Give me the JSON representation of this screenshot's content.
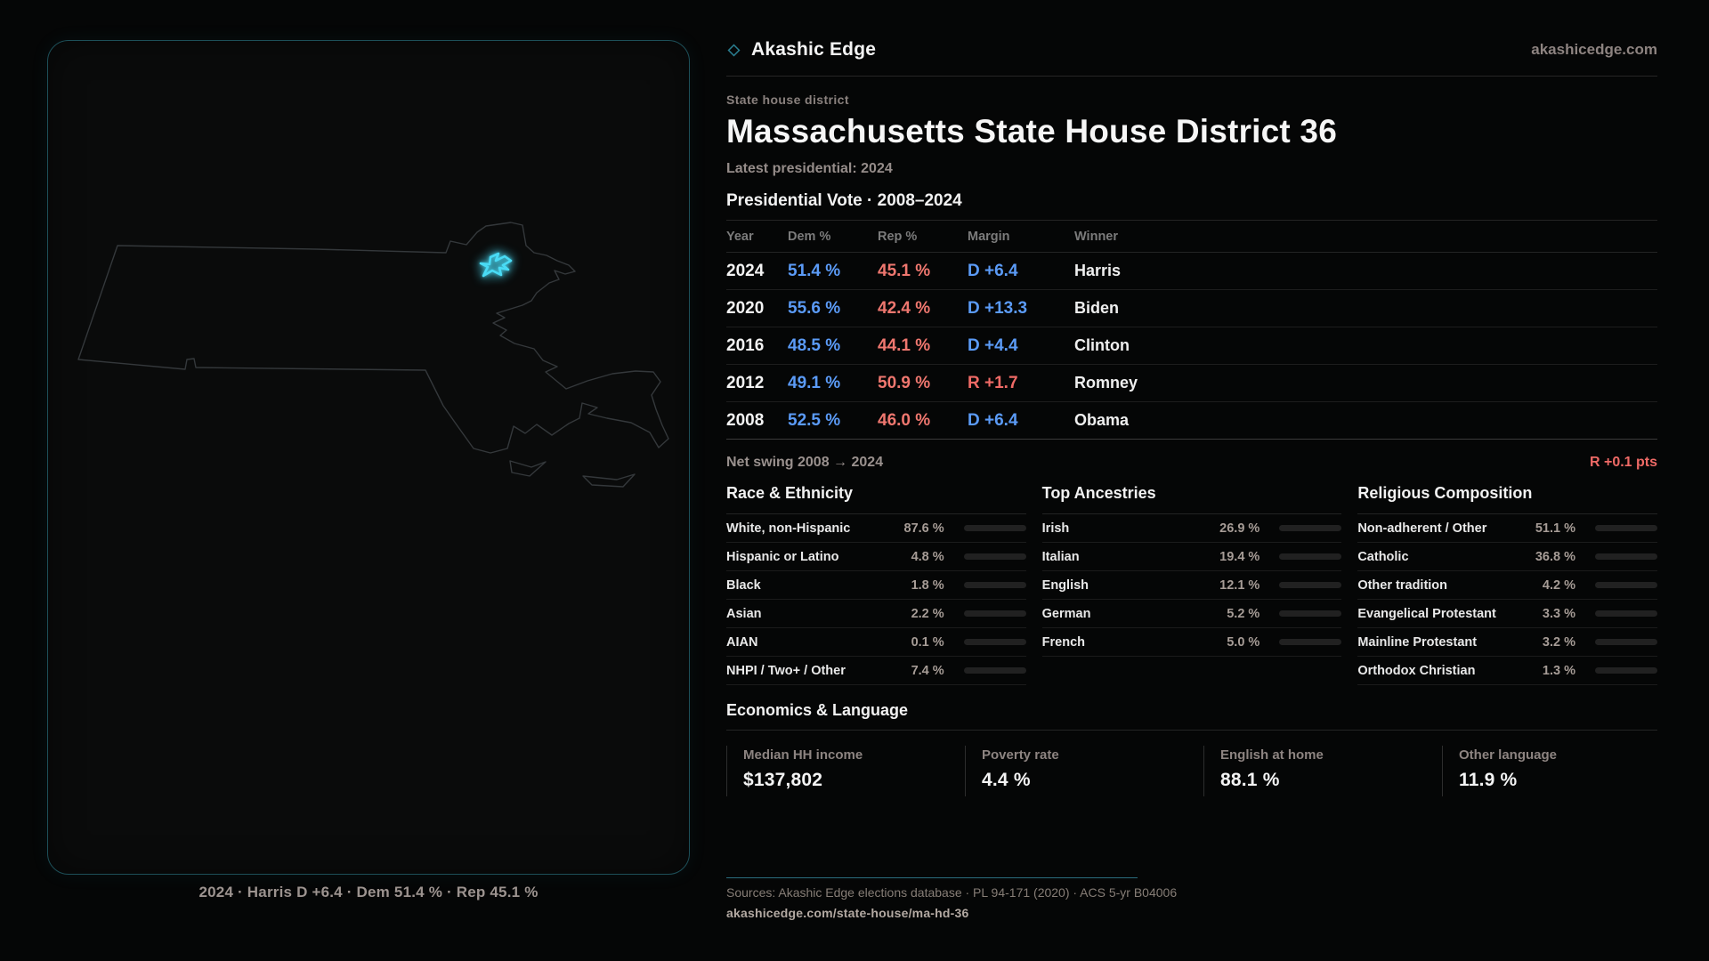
{
  "brand": {
    "name": "Akashic Edge",
    "domain": "akashicedge.com"
  },
  "header": {
    "eyebrow": "State house district",
    "title": "Massachusetts State House District 36",
    "latest": "Latest presidential: 2024"
  },
  "map": {
    "caption": "2024 · Harris D +6.4 · Dem 51.4 % · Rep 45.1 %"
  },
  "vote_table": {
    "title": "Presidential Vote · 2008–2024",
    "columns": [
      "Year",
      "Dem %",
      "Rep %",
      "Margin",
      "Winner"
    ],
    "rows": [
      {
        "year": "2024",
        "dem": "51.4 %",
        "rep": "45.1 %",
        "margin": "D +6.4",
        "margin_party": "D",
        "winner": "Harris"
      },
      {
        "year": "2020",
        "dem": "55.6 %",
        "rep": "42.4 %",
        "margin": "D +13.3",
        "margin_party": "D",
        "winner": "Biden"
      },
      {
        "year": "2016",
        "dem": "48.5 %",
        "rep": "44.1 %",
        "margin": "D +4.4",
        "margin_party": "D",
        "winner": "Clinton"
      },
      {
        "year": "2012",
        "dem": "49.1 %",
        "rep": "50.9 %",
        "margin": "R +1.7",
        "margin_party": "R",
        "winner": "Romney"
      },
      {
        "year": "2008",
        "dem": "52.5 %",
        "rep": "46.0 %",
        "margin": "D +6.4",
        "margin_party": "D",
        "winner": "Obama"
      }
    ],
    "net_swing_label": "Net swing 2008 → 2024",
    "net_swing_value": "R +0.1 pts"
  },
  "demographics": [
    {
      "title": "Race & Ethnicity",
      "rows": [
        {
          "label": "White, non-Hispanic",
          "value": "87.6 %",
          "pct": 87.6
        },
        {
          "label": "Hispanic or Latino",
          "value": "4.8 %",
          "pct": 4.8
        },
        {
          "label": "Black",
          "value": "1.8 %",
          "pct": 1.8
        },
        {
          "label": "Asian",
          "value": "2.2 %",
          "pct": 2.2
        },
        {
          "label": "AIAN",
          "value": "0.1 %",
          "pct": 0.1
        },
        {
          "label": "NHPI / Two+ / Other",
          "value": "7.4 %",
          "pct": 7.4
        }
      ]
    },
    {
      "title": "Top Ancestries",
      "rows": [
        {
          "label": "Irish",
          "value": "26.9 %",
          "pct": 26.9
        },
        {
          "label": "Italian",
          "value": "19.4 %",
          "pct": 19.4
        },
        {
          "label": "English",
          "value": "12.1 %",
          "pct": 12.1
        },
        {
          "label": "German",
          "value": "5.2 %",
          "pct": 5.2
        },
        {
          "label": "French",
          "value": "5.0 %",
          "pct": 5.0
        }
      ]
    },
    {
      "title": "Religious Composition",
      "rows": [
        {
          "label": "Non-adherent / Other",
          "value": "51.1 %",
          "pct": 51.1
        },
        {
          "label": "Catholic",
          "value": "36.8 %",
          "pct": 36.8
        },
        {
          "label": "Other tradition",
          "value": "4.2 %",
          "pct": 4.2
        },
        {
          "label": "Evangelical Protestant",
          "value": "3.3 %",
          "pct": 3.3
        },
        {
          "label": "Mainline Protestant",
          "value": "3.2 %",
          "pct": 3.2
        },
        {
          "label": "Orthodox Christian",
          "value": "1.3 %",
          "pct": 1.3
        }
      ]
    }
  ],
  "economics": {
    "title": "Economics & Language",
    "stats": [
      {
        "label": "Median HH income",
        "value": "$137,802"
      },
      {
        "label": "Poverty rate",
        "value": "4.4 %"
      },
      {
        "label": "English at home",
        "value": "88.1 %"
      },
      {
        "label": "Other language",
        "value": "11.9 %"
      }
    ]
  },
  "footer": {
    "sources": "Sources: Akashic Edge elections database · PL 94-171 (2020) · ACS 5-yr B04006",
    "permalink": "akashicedge.com/state-house/ma-hd-36"
  },
  "colors": {
    "dem_blue": "#5b9bf7",
    "rep_red": "#ef776f",
    "swing_red": "#ef6a66",
    "accent_teal": "#2a7d8f",
    "bar_fill": "#cfcfcf",
    "district_glow": "#49dbf5"
  }
}
